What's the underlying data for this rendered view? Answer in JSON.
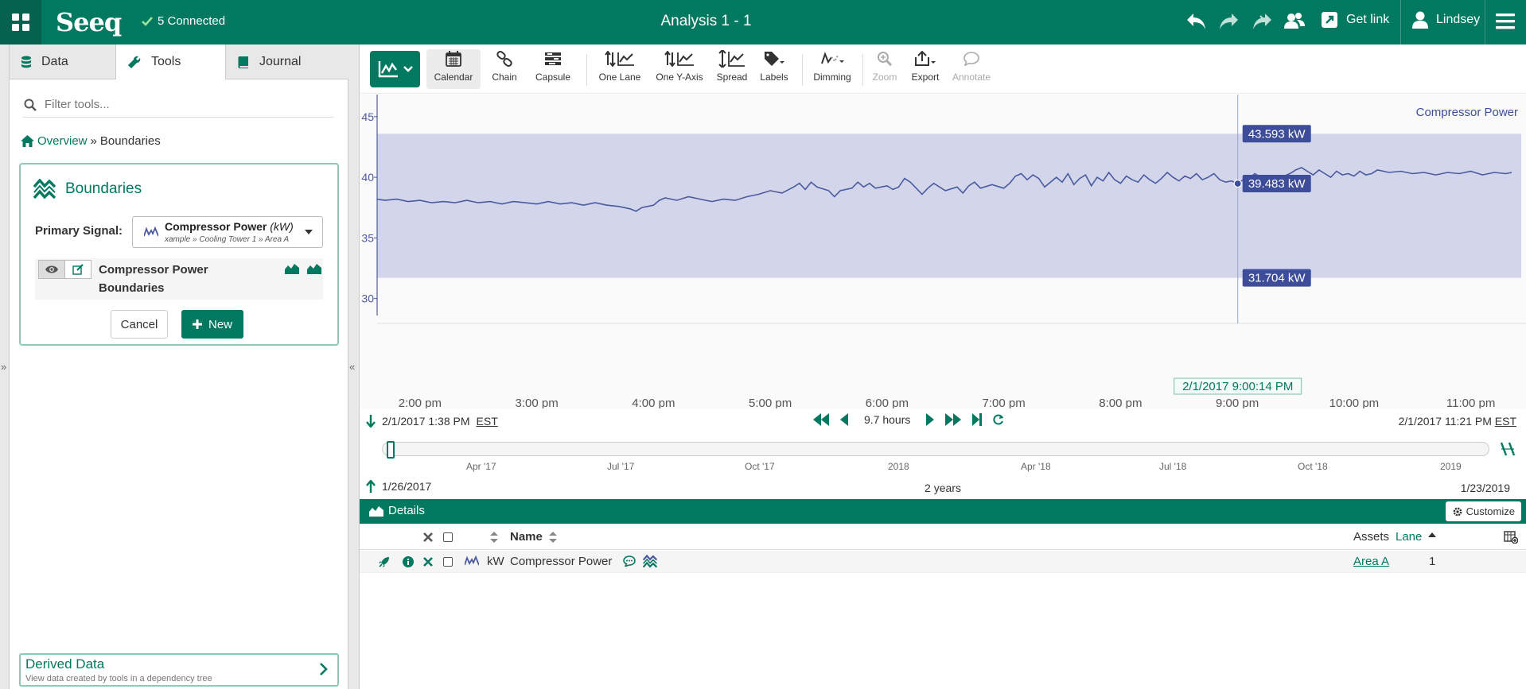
{
  "header": {
    "logo": "Seeq",
    "connected": "5 Connected",
    "title": "Analysis 1 - 1",
    "get_link": "Get link",
    "user": "Lindsey"
  },
  "left_panel": {
    "tabs": [
      {
        "label": "Data",
        "icon": "database-icon"
      },
      {
        "label": "Tools",
        "icon": "wrench-icon"
      },
      {
        "label": "Journal",
        "icon": "book-icon"
      }
    ],
    "filter_placeholder": "Filter tools...",
    "breadcrumb": {
      "home": "Overview",
      "separator": "»",
      "current": "Boundaries"
    },
    "tool": {
      "title": "Boundaries",
      "primary_signal_label": "Primary Signal:",
      "signal_name": "Compressor Power",
      "signal_unit": "(kW)",
      "signal_path": "xample » Cooling Tower 1 » Area A",
      "item_name": "Compressor Power Boundaries",
      "cancel": "Cancel",
      "new": "New"
    },
    "derived": {
      "title": "Derived Data",
      "subtitle": "View data created by tools in a dependency tree"
    }
  },
  "toolbar": {
    "tools": [
      "Calendar",
      "Chain",
      "Capsule",
      "One Lane",
      "One Y-Axis",
      "Spread",
      "Labels",
      "Dimming",
      "Zoom",
      "Export",
      "Annotate"
    ]
  },
  "chart_data": {
    "type": "line",
    "signal_label": "Compressor Power",
    "y_ticks": [
      "45",
      "40",
      "35",
      "30"
    ],
    "ylim": [
      28.6,
      46.3
    ],
    "x_ticks": [
      "2:00 pm",
      "3:00 pm",
      "4:00 pm",
      "5:00 pm",
      "6:00 pm",
      "7:00 pm",
      "8:00 pm",
      "9:00 pm",
      "10:00 pm",
      "11:00 pm"
    ],
    "x_tick_hours": [
      14,
      15,
      16,
      17,
      18,
      19,
      20,
      21,
      22,
      23
    ],
    "x_range_hours": [
      13.633,
      23.35
    ],
    "boundary_upper": 43.593,
    "boundary_lower": 31.704,
    "cursor": {
      "time_hours": 21.004,
      "time_label": "2/1/2017 9:00:14 PM",
      "value": 39.483
    },
    "labels": {
      "upper": "43.593 kW",
      "value": "39.483 kW",
      "lower": "31.704 kW"
    },
    "colors": {
      "line": "#4a5aa0",
      "band": "#d3d6ea",
      "label_bg": "#3e4d99"
    },
    "points": [
      [
        13.63,
        38.2
      ],
      [
        13.7,
        38.1
      ],
      [
        13.8,
        38.2
      ],
      [
        13.9,
        38.0
      ],
      [
        14.0,
        38.1
      ],
      [
        14.1,
        37.9
      ],
      [
        14.2,
        38.0
      ],
      [
        14.3,
        37.9
      ],
      [
        14.4,
        38.1
      ],
      [
        14.5,
        37.9
      ],
      [
        14.6,
        38.0
      ],
      [
        14.7,
        37.8
      ],
      [
        14.8,
        38.0
      ],
      [
        14.9,
        37.9
      ],
      [
        15.0,
        37.8
      ],
      [
        15.1,
        38.0
      ],
      [
        15.2,
        37.8
      ],
      [
        15.3,
        37.9
      ],
      [
        15.4,
        37.7
      ],
      [
        15.5,
        37.9
      ],
      [
        15.6,
        37.7
      ],
      [
        15.7,
        37.6
      ],
      [
        15.8,
        37.4
      ],
      [
        15.85,
        37.2
      ],
      [
        15.9,
        37.5
      ],
      [
        16.0,
        37.7
      ],
      [
        16.05,
        38.1
      ],
      [
        16.1,
        38.3
      ],
      [
        16.2,
        38.1
      ],
      [
        16.3,
        38.4
      ],
      [
        16.4,
        38.2
      ],
      [
        16.5,
        38.0
      ],
      [
        16.6,
        38.2
      ],
      [
        16.7,
        38.1
      ],
      [
        16.8,
        38.4
      ],
      [
        16.9,
        38.6
      ],
      [
        17.0,
        38.9
      ],
      [
        17.1,
        38.7
      ],
      [
        17.2,
        39.2
      ],
      [
        17.25,
        39.5
      ],
      [
        17.3,
        39.0
      ],
      [
        17.35,
        39.6
      ],
      [
        17.4,
        39.2
      ],
      [
        17.5,
        38.9
      ],
      [
        17.55,
        38.4
      ],
      [
        17.6,
        38.9
      ],
      [
        17.7,
        39.1
      ],
      [
        17.75,
        39.6
      ],
      [
        17.8,
        39.2
      ],
      [
        17.85,
        39.5
      ],
      [
        17.9,
        39.1
      ],
      [
        18.0,
        39.3
      ],
      [
        18.05,
        39.0
      ],
      [
        18.1,
        39.2
      ],
      [
        18.15,
        39.9
      ],
      [
        18.2,
        39.6
      ],
      [
        18.25,
        39.1
      ],
      [
        18.3,
        38.6
      ],
      [
        18.35,
        39.1
      ],
      [
        18.4,
        39.5
      ],
      [
        18.5,
        38.9
      ],
      [
        18.6,
        39.2
      ],
      [
        18.65,
        38.7
      ],
      [
        18.7,
        39.3
      ],
      [
        18.75,
        39.6
      ],
      [
        18.8,
        39.1
      ],
      [
        18.9,
        39.4
      ],
      [
        19.0,
        39.1
      ],
      [
        19.05,
        39.5
      ],
      [
        19.1,
        40.1
      ],
      [
        19.15,
        40.3
      ],
      [
        19.2,
        39.8
      ],
      [
        19.25,
        40.2
      ],
      [
        19.3,
        39.9
      ],
      [
        19.35,
        39.2
      ],
      [
        19.4,
        39.6
      ],
      [
        19.45,
        40.0
      ],
      [
        19.5,
        39.6
      ],
      [
        19.55,
        40.3
      ],
      [
        19.6,
        39.4
      ],
      [
        19.65,
        39.9
      ],
      [
        19.7,
        40.2
      ],
      [
        19.75,
        39.3
      ],
      [
        19.8,
        40.0
      ],
      [
        19.85,
        39.7
      ],
      [
        19.9,
        40.4
      ],
      [
        19.95,
        39.8
      ],
      [
        20.0,
        39.5
      ],
      [
        20.05,
        40.1
      ],
      [
        20.1,
        39.8
      ],
      [
        20.15,
        39.6
      ],
      [
        20.2,
        40.2
      ],
      [
        20.25,
        39.8
      ],
      [
        20.3,
        39.5
      ],
      [
        20.35,
        39.9
      ],
      [
        20.4,
        40.4
      ],
      [
        20.45,
        40.0
      ],
      [
        20.5,
        39.7
      ],
      [
        20.55,
        40.1
      ],
      [
        20.6,
        39.9
      ],
      [
        20.65,
        40.3
      ],
      [
        20.7,
        39.8
      ],
      [
        20.75,
        40.0
      ],
      [
        20.8,
        40.3
      ],
      [
        20.85,
        39.8
      ],
      [
        20.9,
        39.6
      ],
      [
        20.95,
        39.7
      ],
      [
        21.0,
        39.48
      ],
      [
        21.05,
        39.8
      ],
      [
        21.1,
        39.9
      ],
      [
        21.15,
        40.3
      ],
      [
        21.2,
        40.0
      ],
      [
        21.25,
        39.7
      ],
      [
        21.3,
        39.9
      ],
      [
        21.35,
        39.6
      ],
      [
        21.4,
        40.1
      ],
      [
        21.45,
        40.3
      ],
      [
        21.5,
        40.6
      ],
      [
        21.55,
        40.8
      ],
      [
        21.6,
        40.5
      ],
      [
        21.65,
        40.2
      ],
      [
        21.7,
        40.6
      ],
      [
        21.75,
        40.3
      ],
      [
        21.8,
        40.0
      ],
      [
        21.85,
        40.5
      ],
      [
        21.9,
        40.2
      ],
      [
        21.95,
        40.3
      ],
      [
        22.0,
        40.1
      ],
      [
        22.05,
        40.5
      ],
      [
        22.1,
        40.2
      ],
      [
        22.15,
        40.3
      ],
      [
        22.2,
        40.6
      ],
      [
        22.3,
        40.4
      ],
      [
        22.4,
        40.5
      ],
      [
        22.5,
        40.3
      ],
      [
        22.6,
        40.4
      ],
      [
        22.7,
        40.2
      ],
      [
        22.8,
        40.4
      ],
      [
        22.9,
        40.3
      ],
      [
        23.0,
        40.5
      ],
      [
        23.1,
        40.2
      ],
      [
        23.2,
        40.4
      ],
      [
        23.3,
        40.3
      ],
      [
        23.35,
        40.4
      ]
    ]
  },
  "time_range": {
    "start": "2/1/2017 1:38 PM",
    "start_tz": "EST",
    "end": "2/1/2017 11:21 PM",
    "end_tz": "EST",
    "duration": "9.7 hours"
  },
  "navigator": {
    "ticks": [
      "Apr '17",
      "Jul '17",
      "Oct '17",
      "2018",
      "Apr '18",
      "Jul '18",
      "Oct '18",
      "2019"
    ],
    "start": "1/26/2017",
    "span": "2 years",
    "end": "1/23/2019"
  },
  "details": {
    "title": "Details",
    "customize": "Customize",
    "col_name": "Name",
    "col_assets": "Assets",
    "col_lane": "Lane",
    "row": {
      "unit": "kW",
      "name": "Compressor Power",
      "asset": "Area A",
      "lane": "1"
    }
  }
}
